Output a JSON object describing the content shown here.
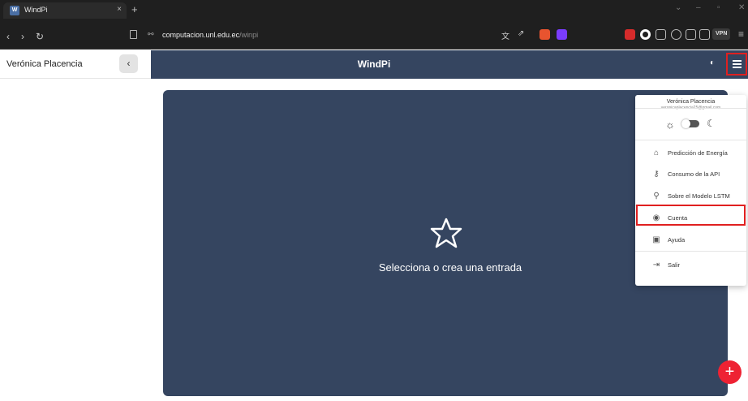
{
  "browser": {
    "tab_title": "WindPi",
    "tab_favicon": "W",
    "close_glyph": "×",
    "new_tab_glyph": "+",
    "address_host": "computacion.unl.edu.ec",
    "address_path": "/winpi",
    "vpn_label": "VPN"
  },
  "sidebar": {
    "user_name": "Verónica Placencia",
    "collapse_glyph": "‹"
  },
  "appbar": {
    "title": "WindPi"
  },
  "main": {
    "empty_text": "Selecciona o crea una entrada",
    "fab_glyph": "+"
  },
  "menu": {
    "user_name": "Verónica Placencia",
    "user_email": "veronicaplacencia25@gmail.com",
    "items": [
      {
        "label": "Predicción de Energía",
        "icon": "home-icon",
        "glyph": "⌂"
      },
      {
        "label": "Consumo de la API",
        "icon": "key-icon",
        "glyph": "⚷"
      },
      {
        "label": "Sobre el Modelo LSTM",
        "icon": "model-icon",
        "glyph": "⚲"
      },
      {
        "label": "Cuenta",
        "icon": "account-icon",
        "glyph": "◉"
      },
      {
        "label": "Ayuda",
        "icon": "help-icon",
        "glyph": "▣"
      },
      {
        "label": "Salir",
        "icon": "logout-icon",
        "glyph": "⇥"
      }
    ]
  },
  "colors": {
    "appbar": "#354560",
    "highlight": "#e02020",
    "fab": "#ee2233"
  }
}
